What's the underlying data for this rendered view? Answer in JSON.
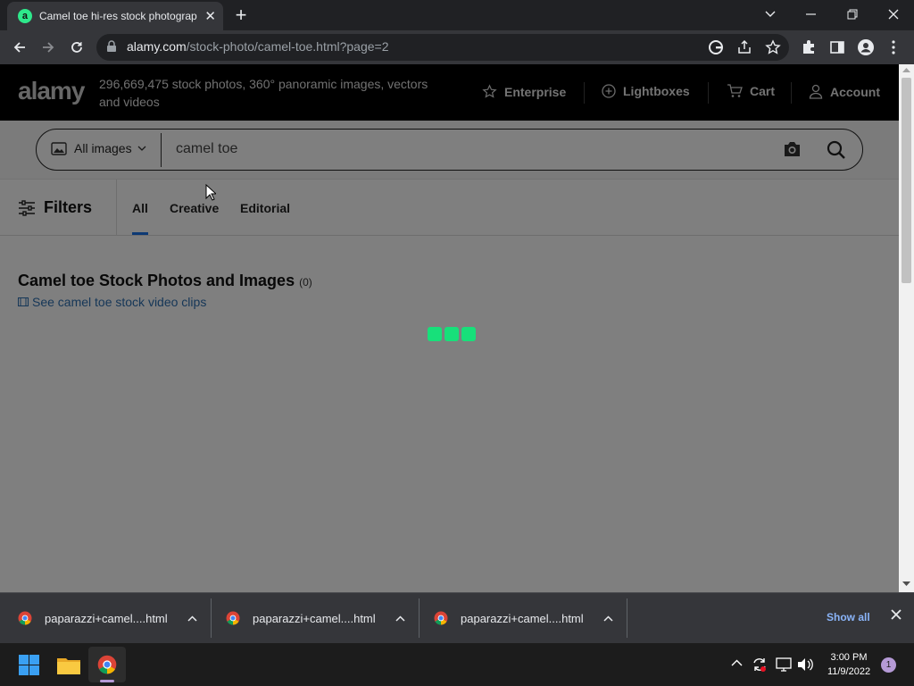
{
  "browser": {
    "tab_title": "Camel toe hi-res stock photograp",
    "tab_favicon_letter": "a",
    "url_host": "alamy.com",
    "url_path": "/stock-photo/camel-toe.html?page=2"
  },
  "site": {
    "logo": "alamy",
    "tagline": "296,669,475 stock photos, 360° panoramic images, vectors and videos",
    "nav": {
      "enterprise": "Enterprise",
      "lightboxes": "Lightboxes",
      "cart": "Cart",
      "account": "Account"
    },
    "search": {
      "scope": "All images",
      "query": "camel toe"
    },
    "filters_label": "Filters",
    "tabs": [
      "All",
      "Creative",
      "Editorial"
    ],
    "heading": "Camel toe Stock Photos and Images",
    "result_count": "(0)",
    "video_link": "See camel toe stock video clips"
  },
  "downloads": {
    "items": [
      "paparazzi+camel....html",
      "paparazzi+camel....html",
      "paparazzi+camel....html"
    ],
    "show_all": "Show all"
  },
  "taskbar": {
    "time": "3:00 PM",
    "date": "11/9/2022",
    "notification_count": "1"
  },
  "colors": {
    "loader": "#17e07a",
    "link": "#2d6fb0",
    "tab_underline": "#1a73e8"
  }
}
